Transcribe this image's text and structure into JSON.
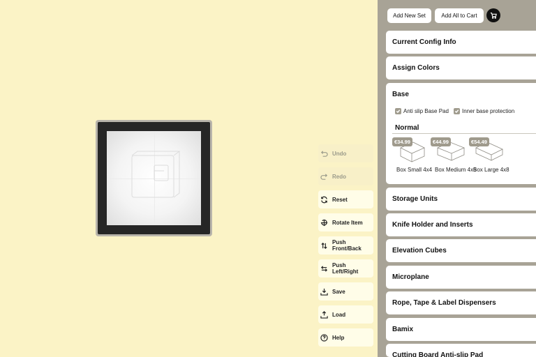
{
  "toolbar": {
    "undo": "Undo",
    "redo": "Redo",
    "reset": "Reset",
    "rotate": "Rotate Item",
    "push_front_back": "Push Front/Back",
    "push_left_right": "Push Left/Right",
    "save": "Save",
    "load": "Load",
    "help": "Help"
  },
  "header": {
    "add_new_set": "Add New Set",
    "add_all_to_cart": "Add All to Cart",
    "cart_icon": "cart-icon"
  },
  "sections": {
    "current_config": "Current Config Info",
    "assign_colors": "Assign Colors",
    "base": "Base",
    "storage_units": "Storage Units",
    "knife_holder": "Knife Holder and Inserts",
    "elevation_cubes": "Elevation Cubes",
    "microplane": "Microplane",
    "dispensers": "Rope, Tape & Label Dispensers",
    "bamix": "Bamix",
    "cutting_board": "Cutting Board Anti-slip Pad"
  },
  "base": {
    "anti_slip": "Anti slip Base Pad",
    "inner_protection": "Inner base protection",
    "anti_slip_checked": true,
    "inner_protection_checked": true,
    "size_group": "Normal",
    "products": [
      {
        "price": "€34.99",
        "name": "Box Small 4x4"
      },
      {
        "price": "€44.99",
        "name": "Box Medium 4x6"
      },
      {
        "price": "€54.49",
        "name": "Box Large 4x8"
      }
    ]
  },
  "colors": {
    "canvas_bg": "#fbf3c6",
    "panel_bg": "#a8a396",
    "tray_frame": "#262626",
    "price_badge": "#9f9a8c"
  }
}
